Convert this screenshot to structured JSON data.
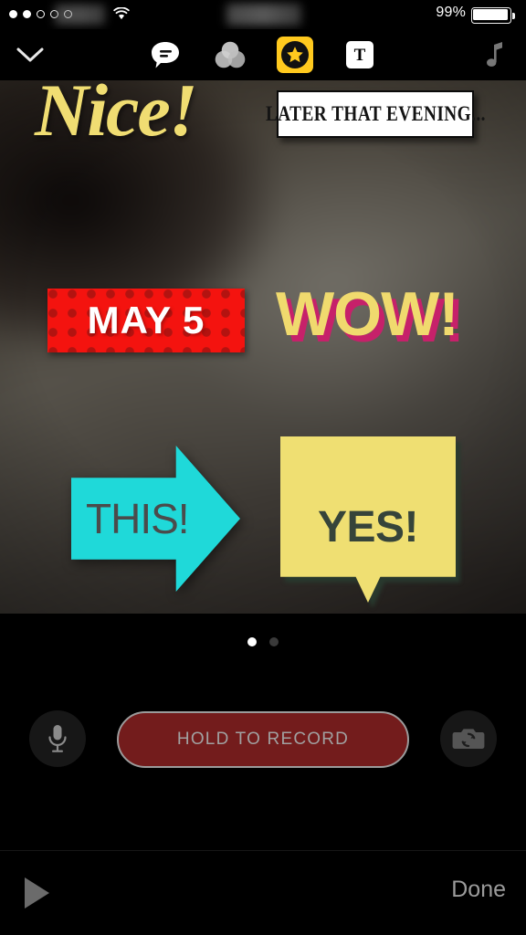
{
  "status_bar": {
    "signal_dots_filled": 2,
    "signal_dots_total": 5,
    "carrier": "",
    "wifi_icon": "wifi-icon",
    "time": "",
    "battery_percent": "99%",
    "battery_icon": "battery-full-icon"
  },
  "toolbar": {
    "items": [
      {
        "name": "collapse-chevron",
        "icon": "chevron-down-icon",
        "label": "",
        "active": false
      },
      {
        "name": "captions",
        "icon": "speech-bubble-icon",
        "label": "",
        "active": false
      },
      {
        "name": "filters",
        "icon": "color-circles-icon",
        "label": "",
        "active": false
      },
      {
        "name": "stickers",
        "icon": "star-icon",
        "label": "",
        "active": true
      },
      {
        "name": "text",
        "icon": "text-t-icon",
        "label": "T",
        "active": false
      },
      {
        "name": "music",
        "icon": "music-note-icon",
        "label": "",
        "active": false
      }
    ],
    "active_accent_color": "#ffc91e"
  },
  "canvas": {
    "stickers": [
      {
        "name": "nice-sticker",
        "text": "Nice!",
        "color": "#f0dd72"
      },
      {
        "name": "later-that-evening-sticker",
        "text": "LATER THAT EVENING...",
        "color": "#141414",
        "background": "#ffffff"
      },
      {
        "name": "may-5-sticker",
        "text": "MAY 5",
        "color": "#ffffff",
        "background": "#f4130f",
        "dot_color": "#b31310"
      },
      {
        "name": "wow-sticker",
        "text": "WOW!",
        "color": "#f0da6e",
        "shadow_color": "#c6216a"
      },
      {
        "name": "this-arrow-sticker",
        "text": "THIS!",
        "color": "#4b4b4b",
        "background": "#1fd9d9"
      },
      {
        "name": "yes-bubble-sticker",
        "text": "YES!",
        "color": "#36443a",
        "background": "#efdf72"
      }
    ]
  },
  "page_indicator": {
    "total": 2,
    "active_index": 0
  },
  "record_bar": {
    "mic_icon": "microphone-icon",
    "record_label": "HOLD TO RECORD",
    "record_color": "#731c1c",
    "flip_camera_icon": "camera-flip-icon"
  },
  "bottom_bar": {
    "play_icon": "play-icon",
    "thumbnail_label": "",
    "done_label": "Done"
  }
}
